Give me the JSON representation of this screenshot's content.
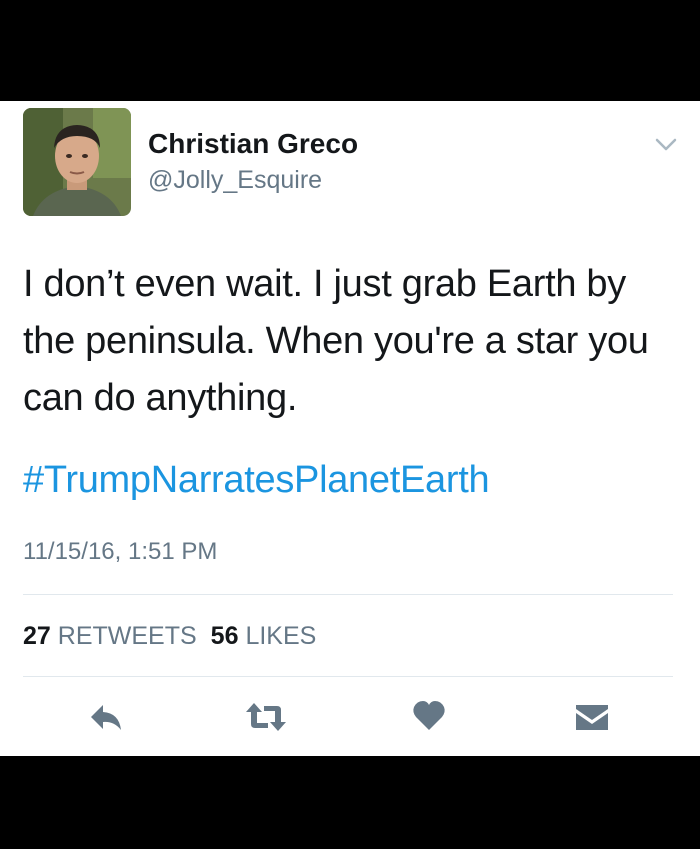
{
  "user": {
    "name": "Christian Greco",
    "handle": "@Jolly_Esquire"
  },
  "tweet": {
    "text": "I don’t even wait. I just grab Earth by the peninsula. When you're a star you can do anything.",
    "hashtag": "#TrumpNarratesPlanetEarth",
    "timestamp": "11/15/16, 1:51 PM"
  },
  "stats": {
    "retweets_count": "27",
    "retweets_label": "RETWEETS",
    "likes_count": "56",
    "likes_label": "LIKES"
  },
  "actions": {
    "icons": [
      "reply-icon",
      "retweet-icon",
      "like-icon",
      "message-icon"
    ]
  },
  "colors": {
    "hashtag": "#1b95e0",
    "secondary_text": "#657786",
    "primary_text": "#14171a",
    "icon": "#657786",
    "divider": "#e1e8ed"
  }
}
